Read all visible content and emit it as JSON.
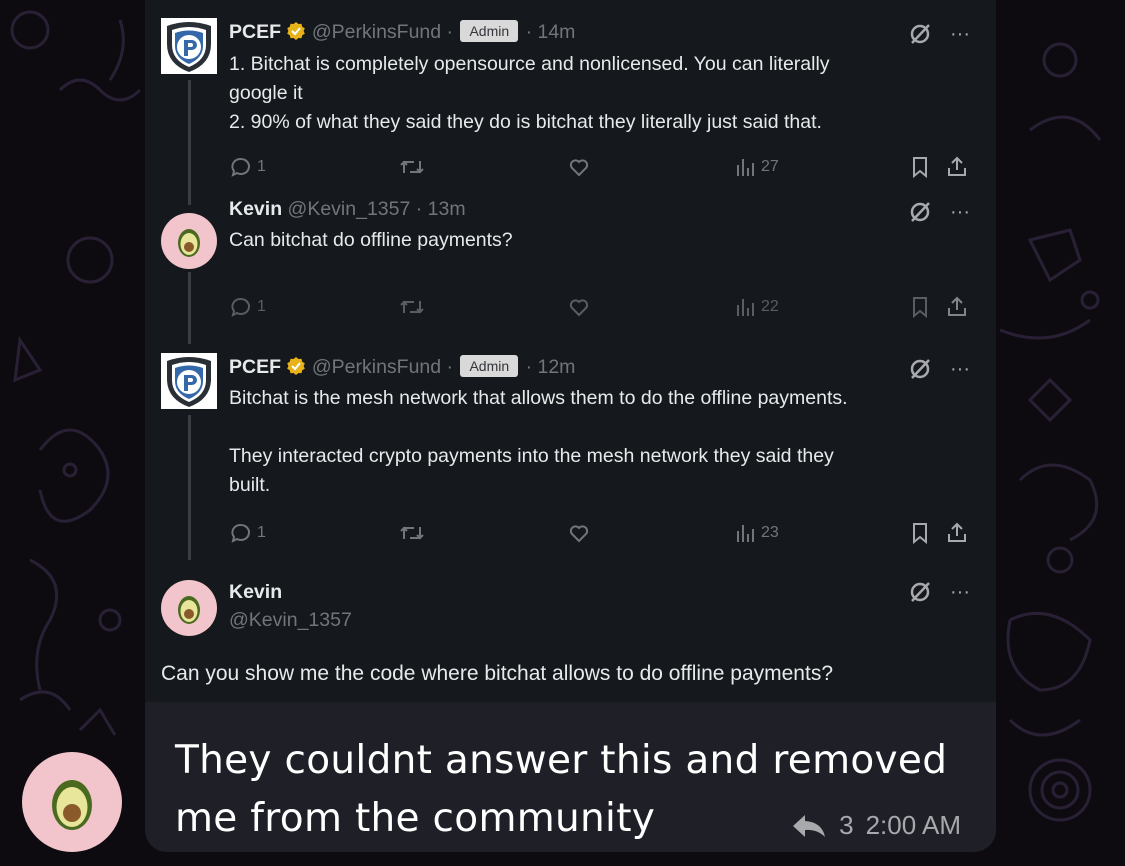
{
  "tweets": [
    {
      "name": "PCEF",
      "handle": "@PerkinsFund ·",
      "badge": "Admin",
      "time": "· 14m",
      "lines": [
        "1. Bitchat is completely opensource and nonlicensed. You can literally",
        "google it",
        "2. 90% of what they said they do is bitchat they literally just said that."
      ],
      "replies": "1",
      "views": "27"
    },
    {
      "name": "Kevin",
      "handle": "@Kevin_1357 · 13m",
      "lines": [
        "Can bitchat do offline payments?"
      ],
      "replies": "1",
      "views": "22"
    },
    {
      "name": "PCEF",
      "handle": "@PerkinsFund ·",
      "badge": "Admin",
      "time": "· 12m",
      "lines": [
        "Bitchat is the mesh network that allows them to do the offline payments.",
        "",
        "They interacted crypto payments into the mesh network they said they",
        "built."
      ],
      "replies": "1",
      "views": "23"
    },
    {
      "name": "Kevin",
      "handle": "@Kevin_1357",
      "text": "Can you show me the code where bitchat allows to do offline payments?"
    }
  ],
  "message": {
    "lines": [
      "They couldnt answer this and removed",
      "me from the community"
    ],
    "reply_count": "3",
    "time": "2:00 AM"
  },
  "icons": {
    "admin_logo": "shield-p-logo",
    "user_avatar": "avocado-icon",
    "grok": "grok-icon",
    "more": "more-icon",
    "reply": "reply-icon",
    "retweet": "retweet-icon",
    "like": "heart-icon",
    "views": "views-icon",
    "bookmark": "bookmark-icon",
    "share": "share-icon",
    "forward": "forward-arrow-icon"
  },
  "colors": {
    "bubble": "#15181c",
    "background": "#0d0b10",
    "muted_text": "#71767b",
    "badge": "#d9d9d9",
    "verified": "#e8b21a",
    "avatar_bg": "#f2c4cb"
  }
}
